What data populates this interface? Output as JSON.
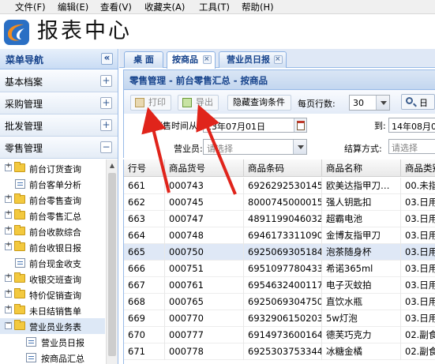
{
  "menu": [
    "文件(F)",
    "编辑(E)",
    "查看(V)",
    "收藏夹(A)",
    "工具(T)",
    "帮助(H)"
  ],
  "app": {
    "title": "报表中心",
    "brand_colors": {
      "orange": "#f28c1e",
      "blue": "#2a6fc4"
    }
  },
  "sidebar": {
    "title": "菜单导航",
    "collapse_symbol": "«",
    "sections": [
      {
        "label": "基本档案",
        "symbol": "+"
      },
      {
        "label": "采购管理",
        "symbol": "+"
      },
      {
        "label": "批发管理",
        "symbol": "+"
      },
      {
        "label": "零售管理",
        "symbol": "−"
      }
    ],
    "tree": [
      {
        "label": "前台订货查询",
        "kind": "folder",
        "symbol": "+"
      },
      {
        "label": "前台客单分析",
        "kind": "doc"
      },
      {
        "label": "前台零售查询",
        "kind": "folder",
        "symbol": "+"
      },
      {
        "label": "前台零售汇总",
        "kind": "folder",
        "symbol": "+"
      },
      {
        "label": "前台收款综合",
        "kind": "folder",
        "symbol": "+"
      },
      {
        "label": "前台收银日报",
        "kind": "folder",
        "symbol": "+"
      },
      {
        "label": "前台现金收支",
        "kind": "doc"
      },
      {
        "label": "收银交班查询",
        "kind": "folder",
        "symbol": "+"
      },
      {
        "label": "特价促销查询",
        "kind": "folder",
        "symbol": "+"
      },
      {
        "label": "未日结销售单",
        "kind": "folder",
        "symbol": "+"
      },
      {
        "label": "营业员业务表",
        "kind": "folder",
        "symbol": "−",
        "selected": true
      },
      {
        "label": "营业员日报",
        "kind": "doc",
        "child": true
      },
      {
        "label": "按商品汇总",
        "kind": "doc",
        "child": true
      }
    ]
  },
  "tabs": [
    {
      "label": "桌 面",
      "closable": false
    },
    {
      "label": "按商品",
      "closable": true,
      "active": true
    },
    {
      "label": "营业员日报",
      "closable": true
    }
  ],
  "panel_title": "零售管理 - 前台零售汇总 - 按商品",
  "toolbar": {
    "print": "打印",
    "export": "导出",
    "hide_query": "隐藏查询条件",
    "rows_label": "每页行数:",
    "rows_value": "30",
    "search_partial": "日"
  },
  "filter": {
    "date_from_label_partial": "销售时间从:",
    "date_from": "13年07月01日",
    "date_to_label": "到:",
    "date_to": "14年08月0",
    "clerk_label": "营业员:",
    "clerk_placeholder": "请选择",
    "settle_label": "结算方式:",
    "settle_placeholder": "请选择"
  },
  "grid": {
    "columns": [
      "行号",
      "商品货号",
      "商品条码",
      "商品名称",
      "商品类别"
    ],
    "rows": [
      [
        "661",
        "000743",
        "6926292530145",
        "欧美达指甲刀…",
        "00.未指"
      ],
      [
        "662",
        "000745",
        "8000745000015",
        "强人钥匙扣",
        "03.日用"
      ],
      [
        "663",
        "000747",
        "4891199046032",
        "超霸电池",
        "03.日用"
      ],
      [
        "664",
        "000748",
        "6946173311090",
        "金博友指甲刀",
        "03.日用"
      ],
      [
        "665",
        "000750",
        "6925069305184",
        "泡茶随身杯",
        "03.日用"
      ],
      [
        "666",
        "000751",
        "6951097780433",
        "希诺365ml",
        "03.日用"
      ],
      [
        "667",
        "000761",
        "6954632400117",
        "电子灭蚊拍",
        "03.日用"
      ],
      [
        "668",
        "000765",
        "6925069304750",
        "直饮水瓶",
        "03.日用"
      ],
      [
        "669",
        "000770",
        "6932906150203",
        "5w灯泡",
        "03.日用"
      ],
      [
        "670",
        "000777",
        "6914973600164",
        "德芙巧克力",
        "02.副食"
      ],
      [
        "671",
        "000778",
        "6925303753344",
        "冰糖金橘",
        "02.副食"
      ]
    ],
    "selected_row": "665"
  },
  "annotation_color": "#e0241b"
}
